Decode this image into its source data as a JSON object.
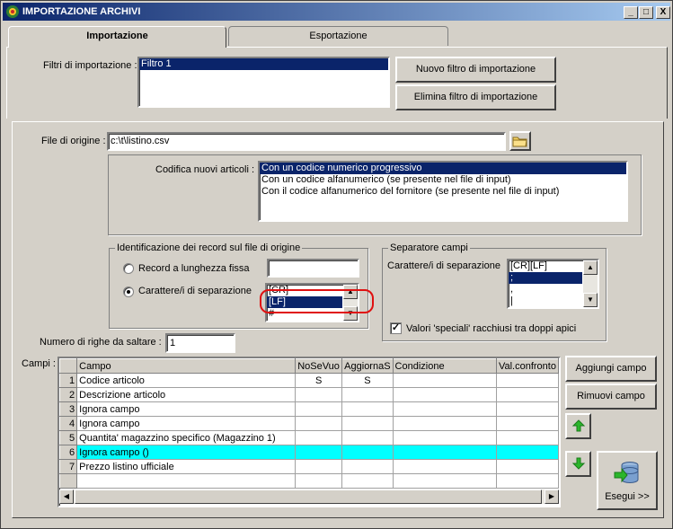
{
  "window": {
    "title": "IMPORTAZIONE ARCHIVI",
    "min": "_",
    "max": "□",
    "close": "X"
  },
  "tabs": [
    {
      "label": "Importazione"
    },
    {
      "label": "Esportazione"
    }
  ],
  "filters": {
    "label": "Filtri di importazione :",
    "items": [
      "Filtro 1"
    ],
    "new_button": "Nuovo filtro di importazione",
    "delete_button": "Elimina filtro di importazione"
  },
  "source": {
    "file_label": "File di origine :",
    "file_value": "c:\\t\\listino.csv",
    "codifica_label": "Codifica nuovi articoli :",
    "codifica_options": [
      "Con un codice numerico progressivo",
      "Con un codice alfanumerico (se presente nel file di input)",
      "Con il codice alfanumerico del fornitore (se presente nel file di input)"
    ]
  },
  "ident": {
    "title": "Identificazione dei record sul file di origine",
    "fixed_label": "Record a lunghezza fissa",
    "fixed_value": "",
    "sep_label": "Carattere/i di separazione",
    "sep_list": [
      "[CR]",
      "[LF]",
      "#"
    ]
  },
  "separator": {
    "title": "Separatore campi",
    "label": "Carattere/i di separazione",
    "list": [
      "[CR][LF]",
      ";",
      ",",
      "|"
    ],
    "quotes_label": "Valori 'speciali' racchiusi tra doppi apici",
    "quotes_checked": "✓"
  },
  "skip": {
    "label": "Numero di righe da saltare :",
    "value": "1"
  },
  "fields": {
    "label": "Campi :",
    "headers": [
      "Campo",
      "NoSeVuo",
      "AggiornaS",
      "Condizione",
      "Val.confronto"
    ],
    "rows": [
      {
        "n": "1",
        "campo": "Codice articolo",
        "noseVuo": "S",
        "aggiorna": "S",
        "condizione": "",
        "val": ""
      },
      {
        "n": "2",
        "campo": "Descrizione articolo",
        "noseVuo": "",
        "aggiorna": "",
        "condizione": "",
        "val": ""
      },
      {
        "n": "3",
        "campo": "Ignora campo",
        "noseVuo": "",
        "aggiorna": "",
        "condizione": "",
        "val": ""
      },
      {
        "n": "4",
        "campo": "Ignora campo",
        "noseVuo": "",
        "aggiorna": "",
        "condizione": "",
        "val": ""
      },
      {
        "n": "5",
        "campo": "Quantita' magazzino specifico (Magazzino 1)",
        "noseVuo": "",
        "aggiorna": "",
        "condizione": "",
        "val": ""
      },
      {
        "n": "6",
        "campo": "Ignora campo ()",
        "noseVuo": "",
        "aggiorna": "",
        "condizione": "",
        "val": ""
      },
      {
        "n": "7",
        "campo": "Prezzo listino ufficiale",
        "noseVuo": "",
        "aggiorna": "",
        "condizione": "",
        "val": ""
      }
    ],
    "add_button": "Aggiungi campo",
    "remove_button": "Rimuovi campo",
    "run_button": "Esegui >>"
  }
}
